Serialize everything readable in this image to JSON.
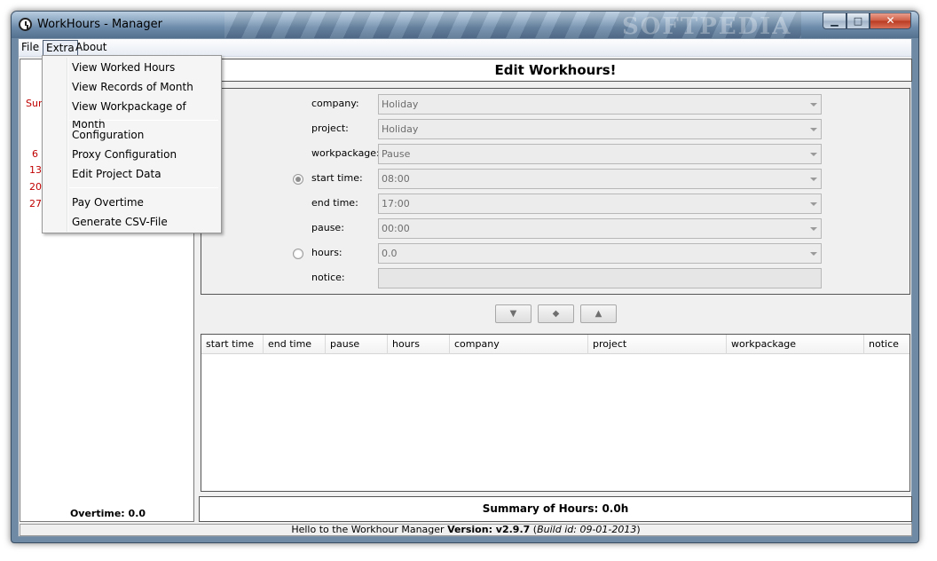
{
  "window": {
    "title": "WorkHours - Manager",
    "watermark": "SOFTPEDIA",
    "controls": {
      "minimize": "▁",
      "maximize": "□",
      "close": "✕"
    }
  },
  "menubar": {
    "file": "File",
    "extra": "Extra",
    "about": "About"
  },
  "extra_menu": {
    "items": [
      "View Worked Hours",
      "View Records of Month",
      "View Workpackage of Month",
      "Configuration",
      "Proxy Configuration",
      "Edit Project Data",
      "Pay Overtime",
      "Generate CSV-File"
    ]
  },
  "calendar": {
    "day_label": "Sun",
    "dates": [
      "6",
      "13",
      "20",
      "27"
    ]
  },
  "left_panel": {
    "overtime": "Overtime: 0.0"
  },
  "edit": {
    "header": "Edit Workhours!",
    "fields": {
      "company": {
        "label": "company:",
        "value": "Holiday"
      },
      "project": {
        "label": "project:",
        "value": "Holiday"
      },
      "workpackage": {
        "label": "workpackage:",
        "value": "Pause"
      },
      "start_time": {
        "label": "start time:",
        "value": "08:00"
      },
      "end_time": {
        "label": "end time:",
        "value": "17:00"
      },
      "pause": {
        "label": "pause:",
        "value": "00:00"
      },
      "hours": {
        "label": "hours:",
        "value": "0.0"
      },
      "notice": {
        "label": "notice:",
        "value": ""
      }
    },
    "nav": {
      "down": "▼",
      "middle": "◆",
      "up": "▲"
    }
  },
  "table": {
    "columns": [
      "start time",
      "end time",
      "pause",
      "hours",
      "company",
      "project",
      "workpackage",
      "notice"
    ]
  },
  "summary": {
    "text": "Summary of Hours: 0.0h"
  },
  "status": {
    "greeting": "Hello to the Workhour Manager ",
    "version_label": "Version: v2.9.7",
    "build_open": " (",
    "build": "Build id: 09-01-2013",
    "build_close": ")"
  }
}
